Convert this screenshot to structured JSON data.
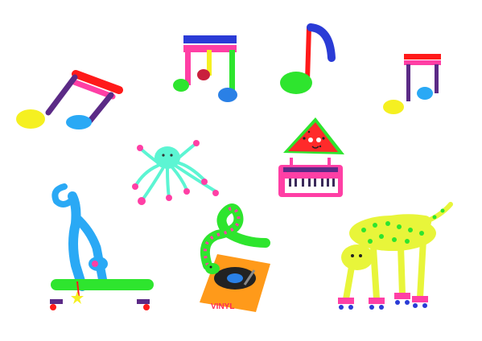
{
  "scene": {
    "background": "#ffffff",
    "illustrations": [
      "music-note-beamed-rainbow",
      "music-note-sixteenth-rainbow",
      "music-note-eighth-blue",
      "music-note-beamed-small",
      "octopus-pink-tentacles",
      "watermelon-on-keyboard",
      "cat-on-skateboard",
      "snake-on-record-player",
      "leopard-on-roller-skates"
    ],
    "record_player_label": "VINYL"
  },
  "palette": {
    "red": "#ff1a1a",
    "pink": "#ff3fa5",
    "purple": "#5b2a86",
    "yellow": "#f5f021",
    "blue": "#2aa9f5",
    "green": "#2ee52e",
    "mint": "#5cf5d3",
    "lime": "#e8f53a",
    "orange": "#ff9a1a"
  }
}
